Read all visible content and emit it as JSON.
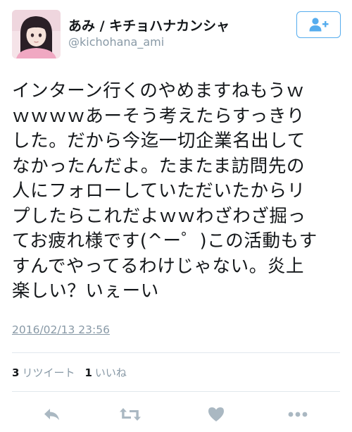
{
  "user": {
    "display_name": "あみ / キチョハナカンシャ",
    "handle": "@kichohana_ami"
  },
  "tweet": {
    "text": "インターン行くのやめますねもうｗ\nｗｗｗｗあーそう考えたらすっきり\nした。だから今迄一切企業名出して\nなかったんだよ。たまたま訪問先の\n人にフォローしていただいたからリ\nプしたらこれだよｗｗわざわざ掘っ\nてお疲れ様です(^ー゜)この活動もす\nすんでやってるわけじゃない。炎上\n楽しい？いぇーい",
    "timestamp": "2016/02/13 23:56"
  },
  "stats": {
    "retweets_count": "3",
    "retweets_label": "リツイート",
    "likes_count": "1",
    "likes_label": "いいね"
  },
  "icons": {
    "follow": "add-user-icon",
    "reply": "reply-icon",
    "retweet": "retweet-icon",
    "like": "heart-icon",
    "more": "more-icon"
  },
  "colors": {
    "accent": "#55acee",
    "muted": "#8899a6",
    "action_icon": "#aab8c2"
  }
}
